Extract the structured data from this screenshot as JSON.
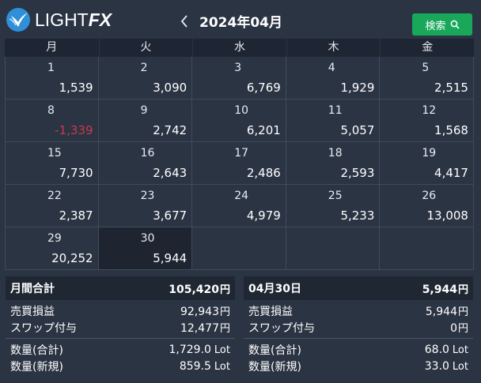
{
  "header": {
    "logo_text_light": "LIGHT",
    "logo_text_fx": "FX",
    "month_title": "2024年04月",
    "search_label": "検索"
  },
  "calendar": {
    "weekdays": [
      "月",
      "火",
      "水",
      "木",
      "金"
    ],
    "cells": [
      {
        "day": "1",
        "pnl": "1,539"
      },
      {
        "day": "2",
        "pnl": "3,090"
      },
      {
        "day": "3",
        "pnl": "6,769"
      },
      {
        "day": "4",
        "pnl": "1,929"
      },
      {
        "day": "5",
        "pnl": "2,515"
      },
      {
        "day": "8",
        "pnl": "-1,339",
        "negative": true
      },
      {
        "day": "9",
        "pnl": "2,742"
      },
      {
        "day": "10",
        "pnl": "6,201"
      },
      {
        "day": "11",
        "pnl": "5,057"
      },
      {
        "day": "12",
        "pnl": "1,568"
      },
      {
        "day": "15",
        "pnl": "7,730"
      },
      {
        "day": "16",
        "pnl": "2,643"
      },
      {
        "day": "17",
        "pnl": "2,486"
      },
      {
        "day": "18",
        "pnl": "2,593"
      },
      {
        "day": "19",
        "pnl": "4,417"
      },
      {
        "day": "22",
        "pnl": "2,387"
      },
      {
        "day": "23",
        "pnl": "3,677"
      },
      {
        "day": "24",
        "pnl": "4,979"
      },
      {
        "day": "25",
        "pnl": "5,233"
      },
      {
        "day": "26",
        "pnl": "13,008"
      },
      {
        "day": "29",
        "pnl": "20,252"
      },
      {
        "day": "30",
        "pnl": "5,944",
        "selected": true
      },
      {
        "day": "",
        "pnl": ""
      },
      {
        "day": "",
        "pnl": ""
      },
      {
        "day": "",
        "pnl": ""
      }
    ]
  },
  "monthly": {
    "title": "月間合計",
    "total_value": "105,420",
    "unit_yen": "円",
    "unit_lot": "Lot",
    "trade_pnl_label": "売買損益",
    "trade_pnl_value": "92,943",
    "swap_label": "スワップ付与",
    "swap_value": "12,477",
    "qty_total_label": "数量(合計)",
    "qty_total_value": "1,729.0",
    "qty_new_label": "数量(新規)",
    "qty_new_value": "859.5"
  },
  "daily": {
    "title": "04月30日",
    "total_value": "5,944",
    "unit_yen": "円",
    "unit_lot": "Lot",
    "trade_pnl_label": "売買損益",
    "trade_pnl_value": "5,944",
    "swap_label": "スワップ付与",
    "swap_value": "0",
    "qty_total_label": "数量(合計)",
    "qty_total_value": "68.0",
    "qty_new_label": "数量(新規)",
    "qty_new_value": "33.0"
  },
  "colors": {
    "background": "#2b3443",
    "accent_green": "#19a85a",
    "negative_red": "#c8394d",
    "logo_blue": "#2f8fd8"
  }
}
